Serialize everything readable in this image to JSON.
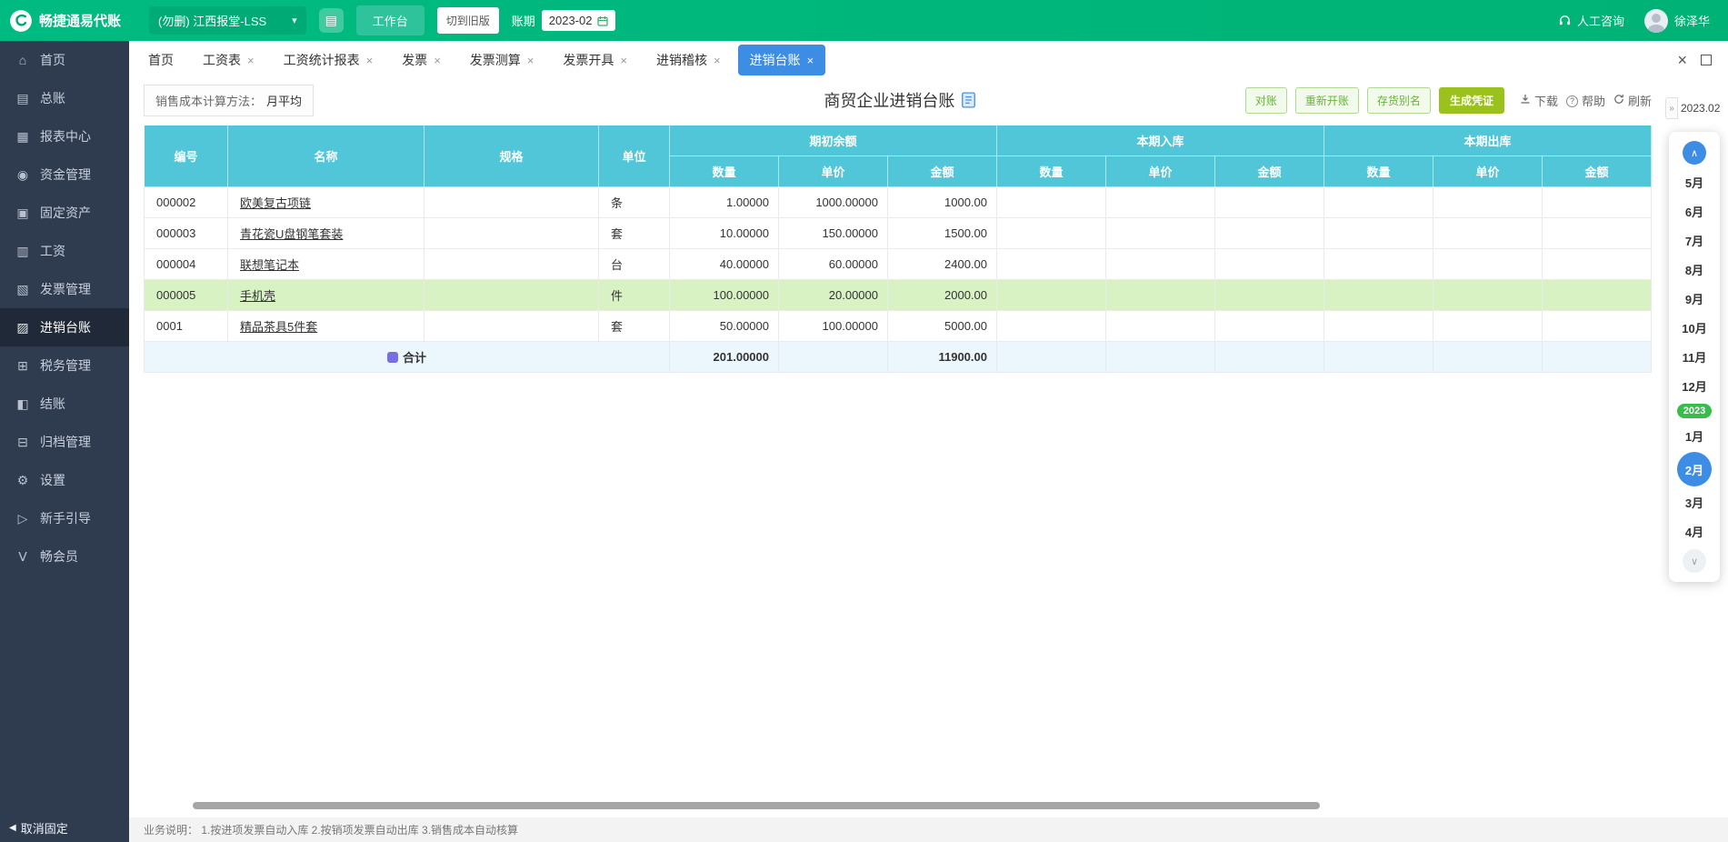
{
  "colors": {
    "topbar_green": "#00b478",
    "sidebar_dark": "#2f3b4f",
    "table_header_cyan": "#52c6d9",
    "active_tab_blue": "#3d8de5",
    "highlight_row_green": "#d9f2c4",
    "voucher_button_green": "#9bc21c"
  },
  "topbar": {
    "logo": "畅捷通易代账",
    "company": "(勿删) 江西报堂-LSS",
    "workbench_button": "工作台",
    "switch_old_button": "切到旧版",
    "period_label": "账期",
    "period_value": "2023-02",
    "support": "人工咨询",
    "username": "徐泽华"
  },
  "sidebar": {
    "items": [
      {
        "label": "首页",
        "icon": "home-icon",
        "active": false
      },
      {
        "label": "总账",
        "icon": "ledger-icon",
        "active": false
      },
      {
        "label": "报表中心",
        "icon": "report-icon",
        "active": false
      },
      {
        "label": "资金管理",
        "icon": "fund-icon",
        "active": false
      },
      {
        "label": "固定资产",
        "icon": "asset-icon",
        "active": false
      },
      {
        "label": "工资",
        "icon": "salary-icon",
        "active": false
      },
      {
        "label": "发票管理",
        "icon": "invoice-icon",
        "active": false
      },
      {
        "label": "进销台账",
        "icon": "inventory-icon",
        "active": true
      },
      {
        "label": "税务管理",
        "icon": "tax-icon",
        "active": false
      },
      {
        "label": "结账",
        "icon": "closing-icon",
        "active": false
      },
      {
        "label": "归档管理",
        "icon": "archive-icon",
        "active": false
      },
      {
        "label": "设置",
        "icon": "settings-icon",
        "active": false
      },
      {
        "label": "新手引导",
        "icon": "guide-icon",
        "active": false
      },
      {
        "label": "畅会员",
        "icon": "member-icon",
        "active": false
      }
    ],
    "unpin": "取消固定"
  },
  "tabs": [
    {
      "label": "首页",
      "closable": false,
      "active": false
    },
    {
      "label": "工资表",
      "closable": true,
      "active": false
    },
    {
      "label": "工资统计报表",
      "closable": true,
      "active": false
    },
    {
      "label": "发票",
      "closable": true,
      "active": false
    },
    {
      "label": "发票测算",
      "closable": true,
      "active": false
    },
    {
      "label": "发票开具",
      "closable": true,
      "active": false
    },
    {
      "label": "进销稽核",
      "closable": true,
      "active": false
    },
    {
      "label": "进销台账",
      "closable": true,
      "active": true
    }
  ],
  "toolbar": {
    "cost_method_label": "销售成本计算方法：",
    "cost_method_value": "月平均",
    "title": "商贸企业进销台账",
    "actions": [
      {
        "label": "对账",
        "type": "outline"
      },
      {
        "label": "重新开账",
        "type": "outline"
      },
      {
        "label": "存货别名",
        "type": "outline"
      },
      {
        "label": "生成凭证",
        "type": "solid"
      }
    ],
    "links": [
      {
        "label": "下载",
        "icon": "download-icon"
      },
      {
        "label": "帮助",
        "icon": "help-icon"
      },
      {
        "label": "刷新",
        "icon": "refresh-icon"
      }
    ]
  },
  "table": {
    "columns": [
      "编号",
      "名称",
      "规格",
      "单位"
    ],
    "groups": [
      {
        "label": "期初余额",
        "children": [
          "数量",
          "单价",
          "金额"
        ]
      },
      {
        "label": "本期入库",
        "children": [
          "数量",
          "单价",
          "金额"
        ]
      },
      {
        "label": "本期出库",
        "children": [
          "数量",
          "单价",
          "金额"
        ]
      }
    ],
    "rows": [
      {
        "code": "000002",
        "name": "欧美复古项链",
        "spec": "",
        "unit": "条",
        "qty": "1.00000",
        "price": "1000.00000",
        "amount": "1000.00",
        "highlight": false
      },
      {
        "code": "000003",
        "name": "青花瓷U盘钢笔套装",
        "spec": "",
        "unit": "套",
        "qty": "10.00000",
        "price": "150.00000",
        "amount": "1500.00",
        "highlight": false
      },
      {
        "code": "000004",
        "name": "联想笔记本",
        "spec": "",
        "unit": "台",
        "qty": "40.00000",
        "price": "60.00000",
        "amount": "2400.00",
        "highlight": false
      },
      {
        "code": "000005",
        "name": "手机壳",
        "spec": "",
        "unit": "件",
        "qty": "100.00000",
        "price": "20.00000",
        "amount": "2000.00",
        "highlight": true
      },
      {
        "code": "0001",
        "name": "精品茶具5件套",
        "spec": "",
        "unit": "套",
        "qty": "50.00000",
        "price": "100.00000",
        "amount": "5000.00",
        "highlight": false
      }
    ],
    "total": {
      "label": "合计",
      "qty": "201.00000",
      "amount": "11900.00"
    }
  },
  "calendar": {
    "collapse_handle": "»",
    "current_period": "2023.02",
    "months": [
      "5月",
      "6月",
      "7月",
      "8月",
      "9月",
      "10月",
      "11月",
      "12月",
      "1月",
      "2月",
      "3月",
      "4月"
    ],
    "active_month": "2月",
    "year_badge": "2023",
    "year_badge_before": "1月"
  },
  "footer": {
    "note": "业务说明： 1.按进项发票自动入库  2.按销项发票自动出库  3.销售成本自动核算"
  }
}
